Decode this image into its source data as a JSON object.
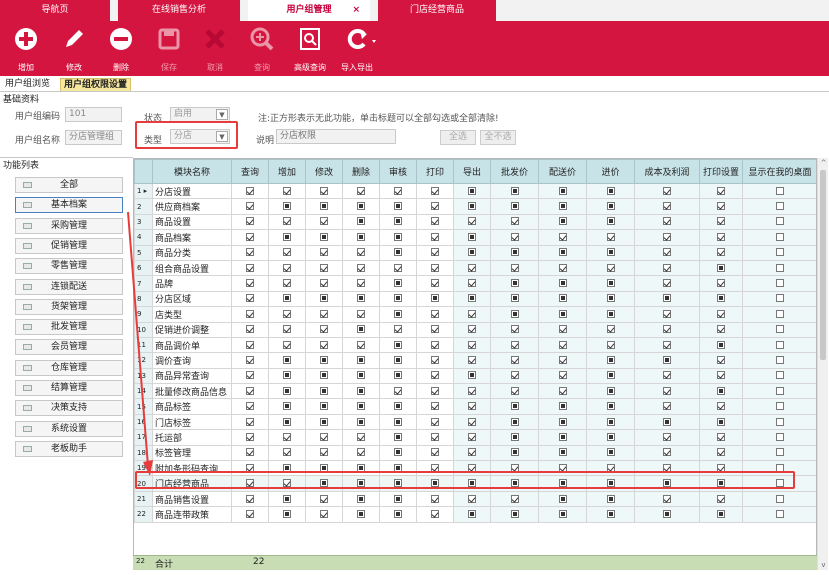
{
  "tabs": [
    {
      "label": "导航页"
    },
    {
      "label": "在线销售分析"
    },
    {
      "label": "用户组管理",
      "close": "×"
    },
    {
      "label": "门店经营商品"
    }
  ],
  "toolbar": [
    {
      "label": "增加",
      "icon": "plus-circle-icon"
    },
    {
      "label": "修改",
      "icon": "pencil-icon"
    },
    {
      "label": "删除",
      "icon": "minus-circle-icon"
    },
    {
      "label": "保存",
      "icon": "floppy-icon"
    },
    {
      "label": "取消",
      "icon": "x-icon"
    },
    {
      "label": "查询",
      "icon": "zoom-icon"
    },
    {
      "label": "高级查询",
      "icon": "advanced-search-icon"
    },
    {
      "label": "导入导出",
      "icon": "refresh-icon"
    }
  ],
  "subtabs": [
    "用户组浏览",
    "用户组权限设置"
  ],
  "basic": {
    "section": "基础资料",
    "code_label": "用户组编码",
    "code_value": "101",
    "name_label": "用户组名称",
    "name_value": "分店管理组",
    "status_label": "状态",
    "status_value": "启用",
    "type_label": "类型",
    "type_value": "分店",
    "desc_label": "说明",
    "desc_value": "分店权限",
    "hint": "注:正方形表示无此功能，单击标题可以全部勾选或全部清除!",
    "select_all": "全选",
    "select_none": "全不选"
  },
  "func": {
    "section": "功能列表",
    "items": [
      "全部",
      "基本档案",
      "采购管理",
      "促销管理",
      "零售管理",
      "连锁配送",
      "货架管理",
      "批发管理",
      "会员管理",
      "仓库管理",
      "结算管理",
      "决策支持",
      "系统设置",
      "老板助手"
    ]
  },
  "grid": {
    "headers": [
      "模块名称",
      "查询",
      "增加",
      "修改",
      "删除",
      "审核",
      "打印",
      "导出",
      "批发价",
      "配送价",
      "进价",
      "成本及利润",
      "打印设置",
      "显示在我的桌面"
    ],
    "rows": [
      {
        "n": "1 ▸",
        "name": "分店设置",
        "v": "ccccccmmmmccu"
      },
      {
        "n": "2",
        "name": "供应商档案",
        "v": "cmmmmcmmmmccu"
      },
      {
        "n": "3",
        "name": "商品设置",
        "v": "cccmmcccmmccu"
      },
      {
        "n": "4",
        "name": "商品档案",
        "v": "cmmmmcmcccccu"
      },
      {
        "n": "5",
        "name": "商品分类",
        "v": "ccccmcmmmmccu"
      },
      {
        "n": "6",
        "name": "组合商品设置",
        "v": "cccccccccccmu"
      },
      {
        "n": "7",
        "name": "品牌",
        "v": "ccccmccmmmccu"
      },
      {
        "n": "8",
        "name": "分店区域",
        "v": "cmmmmmmmmmmmu"
      },
      {
        "n": "9",
        "name": "店类型",
        "v": "ccccmccmmmccu"
      },
      {
        "n": "10",
        "name": "促销进价调整",
        "v": "cccmccccccccu"
      },
      {
        "n": "11",
        "name": "商品调价单",
        "v": "ccccmccccccmu"
      },
      {
        "n": "12",
        "name": "调价查询",
        "v": "cmmmmccccmmcu"
      },
      {
        "n": "13",
        "name": "商品异常查询",
        "v": "cmmmmcmccmccu"
      },
      {
        "n": "14",
        "name": "批量修改商品信息",
        "v": "cmmmcccccmcmu"
      },
      {
        "n": "15",
        "name": "商品标签",
        "v": "cmmmmccmmmccu"
      },
      {
        "n": "16",
        "name": "门店标签",
        "v": "cmmmmccmmmmmu"
      },
      {
        "n": "17",
        "name": "托运部",
        "v": "ccccmccmmmccu"
      },
      {
        "n": "18",
        "name": "标签管理",
        "v": "ccccmccmmmccu"
      },
      {
        "n": "19",
        "name": "附加条形码查询",
        "v": "cmmmmcccccccu"
      },
      {
        "n": "20",
        "name": "门店经营商品",
        "v": "ccmmmmmmmmmmu"
      },
      {
        "n": "21",
        "name": "商品销售设置",
        "v": "cmcmmcccmmccu"
      },
      {
        "n": "22",
        "name": "商品连带政策",
        "v": "cmcmmcmmmmmmu"
      }
    ],
    "total_rn": "22",
    "total_label": "合计",
    "total_value": "22"
  }
}
